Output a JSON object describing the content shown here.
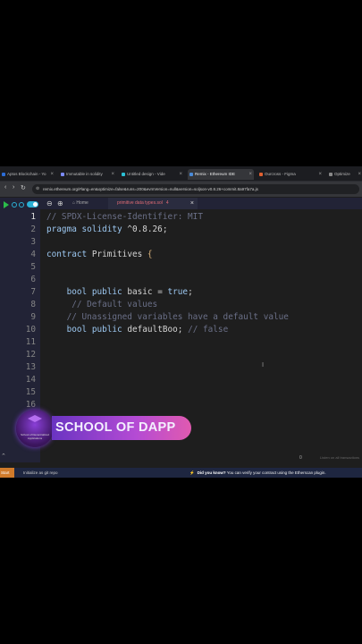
{
  "browser": {
    "tabs": [
      {
        "label": "Aptos Blockchain - Yo",
        "fav": "#2b6cd6",
        "active": false
      },
      {
        "label": "Immutable in solidity",
        "fav": "#7b8bff",
        "active": false
      },
      {
        "label": "Untitled design - Vide",
        "fav": "#2bc0d4",
        "active": false
      },
      {
        "label": "Remix - Ethereum IDE",
        "fav": "#4a8ad8",
        "active": true
      },
      {
        "label": "Ourcross - Figma",
        "fav": "#e06030",
        "active": false
      },
      {
        "label": "Optimize",
        "fav": "#888888",
        "active": false
      }
    ],
    "url": "remix.ethereum.org/#lang=en&optimize=false&runs=200&evmVersion=null&version=soljson-v0.8.26+commit.8a97fa7a.js"
  },
  "editor": {
    "home_tab": "Home",
    "file_tab": "primitive data types.sol",
    "file_tab_count": "4",
    "lines": [
      {
        "n": "1",
        "parts": [
          {
            "t": "// SPDX-License-Identifier: MIT",
            "c": "cm"
          }
        ]
      },
      {
        "n": "2",
        "parts": [
          {
            "t": "pragma solidity ",
            "c": "kw"
          },
          {
            "t": "^0.8.26;",
            "c": "id"
          }
        ]
      },
      {
        "n": "3",
        "parts": []
      },
      {
        "n": "4",
        "parts": [
          {
            "t": "contract ",
            "c": "kw"
          },
          {
            "t": "Primitives ",
            "c": "id"
          },
          {
            "t": "{",
            "c": "str"
          }
        ]
      },
      {
        "n": "5",
        "parts": []
      },
      {
        "n": "6",
        "parts": []
      },
      {
        "n": "7",
        "parts": [
          {
            "t": "    bool ",
            "c": "kw"
          },
          {
            "t": "public ",
            "c": "kw"
          },
          {
            "t": "basic = ",
            "c": "id"
          },
          {
            "t": "true",
            "c": "kw"
          },
          {
            "t": ";",
            "c": "id"
          }
        ]
      },
      {
        "n": "8",
        "parts": [
          {
            "t": "     // Default values",
            "c": "cm"
          }
        ]
      },
      {
        "n": "9",
        "parts": [
          {
            "t": "    // Unassigned variables have a default value",
            "c": "cm"
          }
        ]
      },
      {
        "n": "10",
        "parts": [
          {
            "t": "    bool ",
            "c": "kw"
          },
          {
            "t": "public ",
            "c": "kw"
          },
          {
            "t": "defaultBoo; ",
            "c": "id"
          },
          {
            "t": "// false",
            "c": "cm"
          }
        ]
      },
      {
        "n": "11",
        "parts": []
      },
      {
        "n": "12",
        "parts": []
      },
      {
        "n": "13",
        "parts": []
      },
      {
        "n": "14",
        "parts": []
      },
      {
        "n": "15",
        "parts": []
      },
      {
        "n": "16",
        "parts": []
      }
    ]
  },
  "overlay": {
    "banner": "SCHOOL OF DAPP",
    "logo_sub": "School of Decentralized Applications"
  },
  "status": {
    "start": "Start",
    "git": "Initialize as git repo",
    "tip_title": "Did you know?",
    "tip_text": "You can verify your contract using the Etherscan plugin.",
    "terminal_count": "0",
    "listen": "Listen on all transactions"
  }
}
